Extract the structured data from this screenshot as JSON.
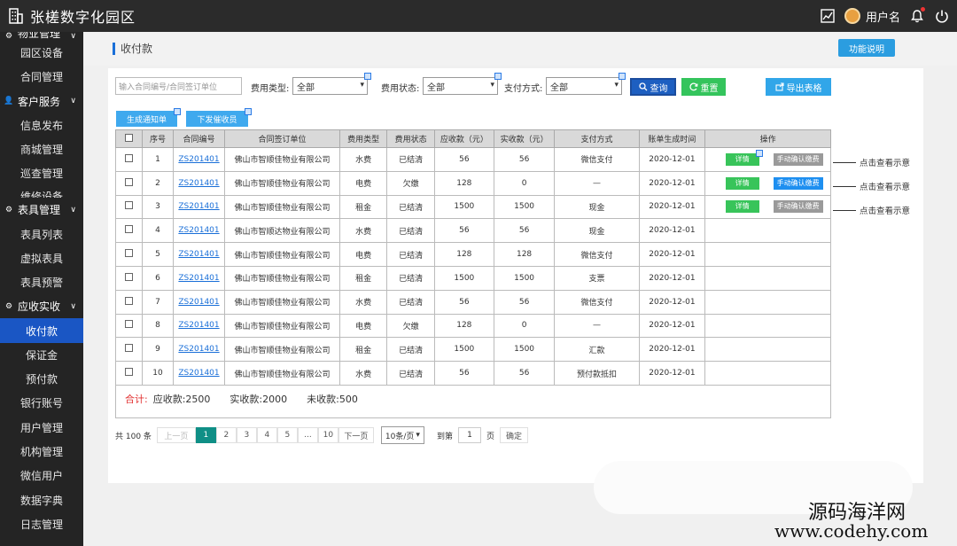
{
  "app": {
    "title": "张槎数字化园区",
    "username": "用户名"
  },
  "sidebar": {
    "groups": [
      {
        "label": "物业管理",
        "icon": "gear-icon",
        "items": [
          "园区设备",
          "合同管理"
        ]
      },
      {
        "label": "客户服务",
        "icon": "person-icon",
        "items": [
          "信息发布",
          "商城管理",
          "巡查管理",
          "维修设备"
        ]
      },
      {
        "label": "表具管理",
        "icon": "gear-icon",
        "items": [
          "表具列表",
          "虚拟表具",
          "表具预警"
        ]
      },
      {
        "label": "应收实收",
        "icon": "gear-icon",
        "items": [
          "收付款",
          "保证金",
          "预付款",
          "银行账号",
          "用户管理",
          "机构管理",
          "微信用户",
          "数据字典",
          "日志管理"
        ]
      }
    ],
    "active": "收付款"
  },
  "page": {
    "title": "收付款",
    "help_button": "功能说明"
  },
  "filters": {
    "contract_placeholder": "输入合同编号/合同签订单位",
    "fee_type_label": "费用类型:",
    "fee_type_value": "全部",
    "fee_status_label": "费用状态:",
    "fee_status_value": "全部",
    "pay_method_label": "支付方式:",
    "pay_method_value": "全部",
    "query_button": "查询",
    "reset_button": "重置",
    "export_button": "导出表格",
    "gen_notice_button": "生成通知单",
    "send_reminder_button": "下发催收员"
  },
  "table": {
    "columns": [
      "序号",
      "合同编号",
      "合同签订单位",
      "费用类型",
      "费用状态",
      "应收款（元）",
      "实收款（元）",
      "支付方式",
      "账单生成时间",
      "操作"
    ],
    "rows": [
      {
        "no": "1",
        "contract": "ZS201401",
        "unit": "佛山市智顺佳物业有限公司",
        "type": "水费",
        "status": "已结清",
        "due": "56",
        "paid": "56",
        "method": "微信支付",
        "time": "2020-12-01",
        "detail": "详情",
        "confirm": "手动确认缴费",
        "confirm_style": "gray"
      },
      {
        "no": "2",
        "contract": "ZS201401",
        "unit": "佛山市智顺佳物业有限公司",
        "type": "电费",
        "status": "欠缴",
        "due": "128",
        "paid": "0",
        "method": "—",
        "time": "2020-12-01",
        "detail": "详情",
        "confirm": "手动确认缴费",
        "confirm_style": "blue"
      },
      {
        "no": "3",
        "contract": "ZS201401",
        "unit": "佛山市智顺佳物业有限公司",
        "type": "租金",
        "status": "已结清",
        "due": "1500",
        "paid": "1500",
        "method": "现金",
        "time": "2020-12-01",
        "detail": "详情",
        "confirm": "手动确认缴费",
        "confirm_style": "gray"
      },
      {
        "no": "4",
        "contract": "ZS201401",
        "unit": "佛山市智顺达物业有限公司",
        "type": "水费",
        "status": "已结清",
        "due": "56",
        "paid": "56",
        "method": "现金",
        "time": "2020-12-01"
      },
      {
        "no": "5",
        "contract": "ZS201401",
        "unit": "佛山市智顺佳物业有限公司",
        "type": "电费",
        "status": "已结清",
        "due": "128",
        "paid": "128",
        "method": "微信支付",
        "time": "2020-12-01"
      },
      {
        "no": "6",
        "contract": "ZS201401",
        "unit": "佛山市智顺佳物业有限公司",
        "type": "租金",
        "status": "已结清",
        "due": "1500",
        "paid": "1500",
        "method": "支票",
        "time": "2020-12-01"
      },
      {
        "no": "7",
        "contract": "ZS201401",
        "unit": "佛山市智顺佳物业有限公司",
        "type": "水费",
        "status": "已结清",
        "due": "56",
        "paid": "56",
        "method": "微信支付",
        "time": "2020-12-01"
      },
      {
        "no": "8",
        "contract": "ZS201401",
        "unit": "佛山市智顺佳物业有限公司",
        "type": "电费",
        "status": "欠缴",
        "due": "128",
        "paid": "0",
        "method": "—",
        "time": "2020-12-01"
      },
      {
        "no": "9",
        "contract": "ZS201401",
        "unit": "佛山市智顺佳物业有限公司",
        "type": "租金",
        "status": "已结清",
        "due": "1500",
        "paid": "1500",
        "method": "汇款",
        "time": "2020-12-01"
      },
      {
        "no": "10",
        "contract": "ZS201401",
        "unit": "佛山市智顺佳物业有限公司",
        "type": "水费",
        "status": "已结清",
        "due": "56",
        "paid": "56",
        "method": "预付款抵扣",
        "time": "2020-12-01"
      }
    ]
  },
  "summary": {
    "label": "合计:",
    "due": "应收款:2500",
    "paid": "实收款:2000",
    "unpaid": "未收款:500"
  },
  "pager": {
    "total": "共 100 条",
    "prev": "上一页",
    "pages": [
      "1",
      "2",
      "3",
      "4",
      "5",
      "...",
      "10"
    ],
    "current": "1",
    "next": "下一页",
    "page_size": "10条/页",
    "goto_label": "到第",
    "goto_value": "1",
    "page_unit": "页",
    "confirm": "确定"
  },
  "annotations": [
    "点击查看示意",
    "点击查看示意",
    "点击查看示意"
  ],
  "watermark": {
    "line1": "源码海洋网",
    "line2": "www.codehy.com"
  },
  "colors": {
    "topbar": "#2b2b2b",
    "sidebar": "#242424",
    "active": "#1a56c4",
    "accent": "#1a6fd8",
    "green": "#38c45a",
    "red": "#e23232",
    "page_active": "#0f8f86"
  }
}
